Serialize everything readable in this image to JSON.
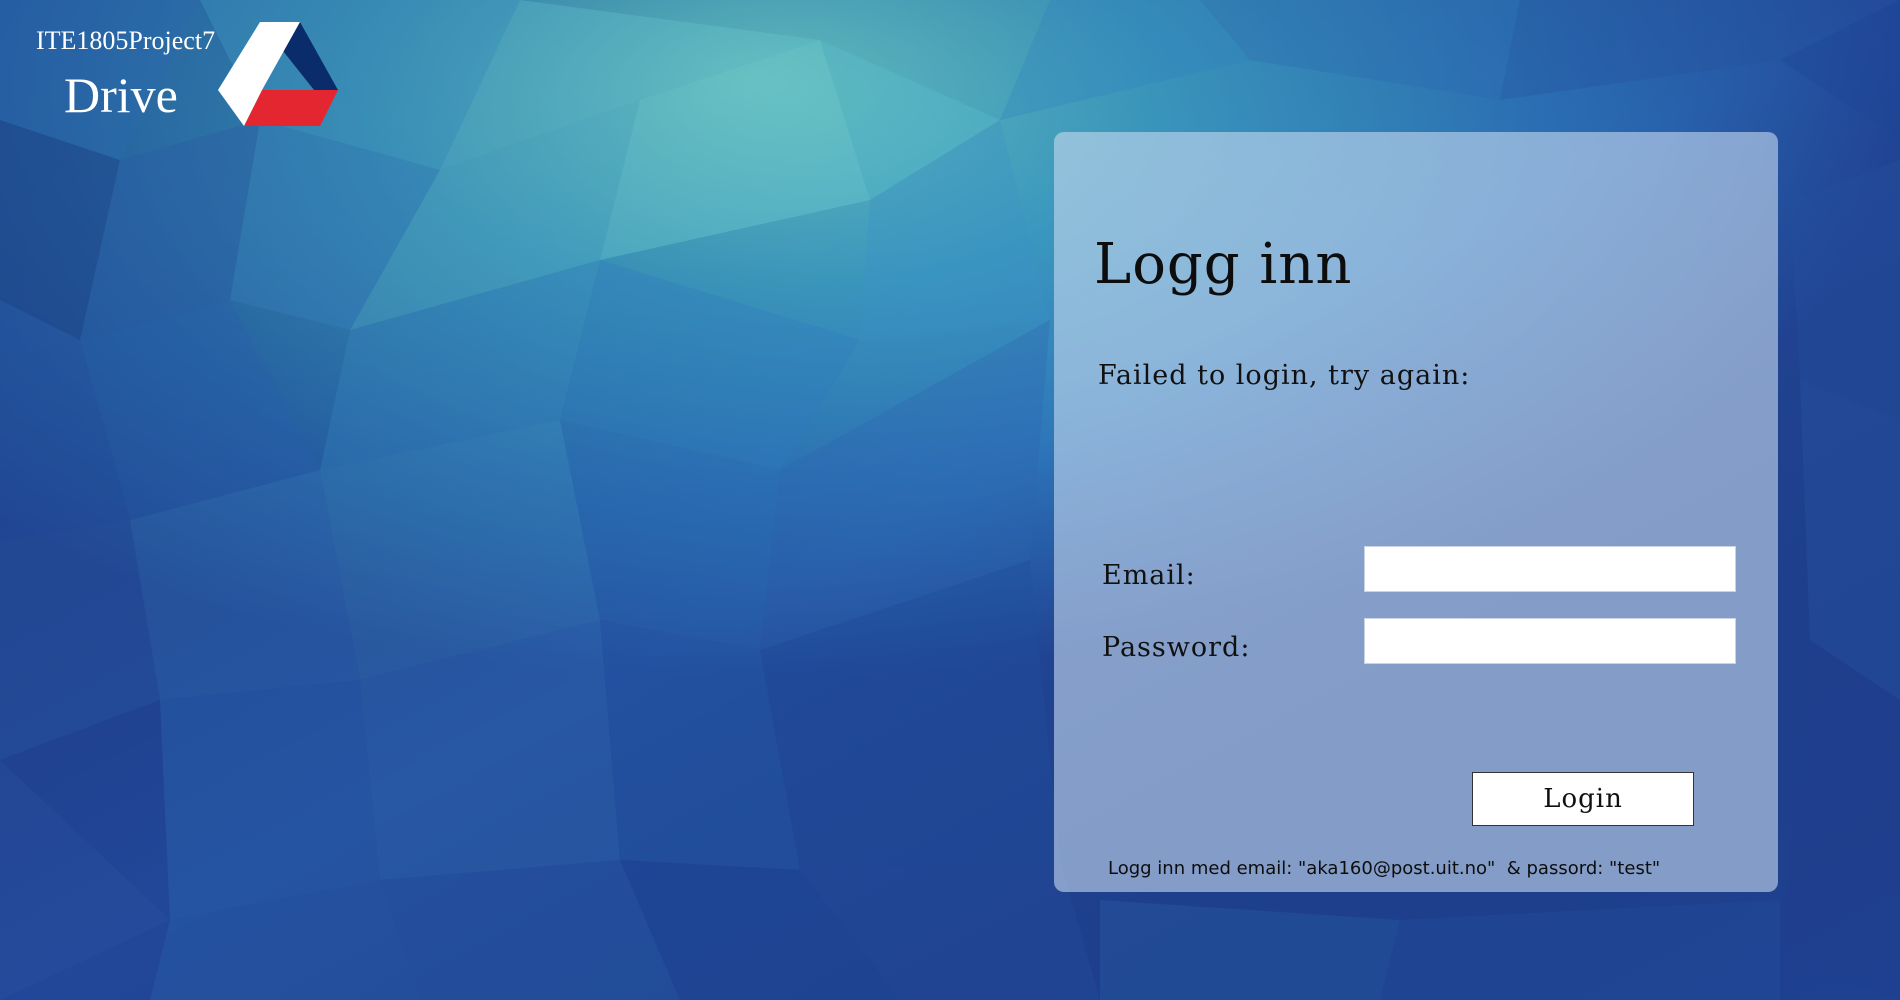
{
  "brand": {
    "project_name": "ITE1805Project7",
    "app_name": "Drive",
    "logo_icon": "drive-triangle-logo-icon",
    "colors": {
      "navy": "#0b2c6b",
      "red": "#e3262f",
      "white": "#ffffff"
    }
  },
  "login": {
    "title": "Logg inn",
    "error_message": "Failed to login, try again:",
    "email_label": "Email:",
    "email_value": "",
    "password_label": "Password:",
    "password_value": "",
    "submit_label": "Login",
    "hint": "Logg inn med email: \"aka160@post.uit.no\"  & passord: \"test\""
  },
  "theme": {
    "background": "#2d6bb2",
    "background_highlight": "#6fd4d8",
    "panel": "#c4d6ee"
  }
}
